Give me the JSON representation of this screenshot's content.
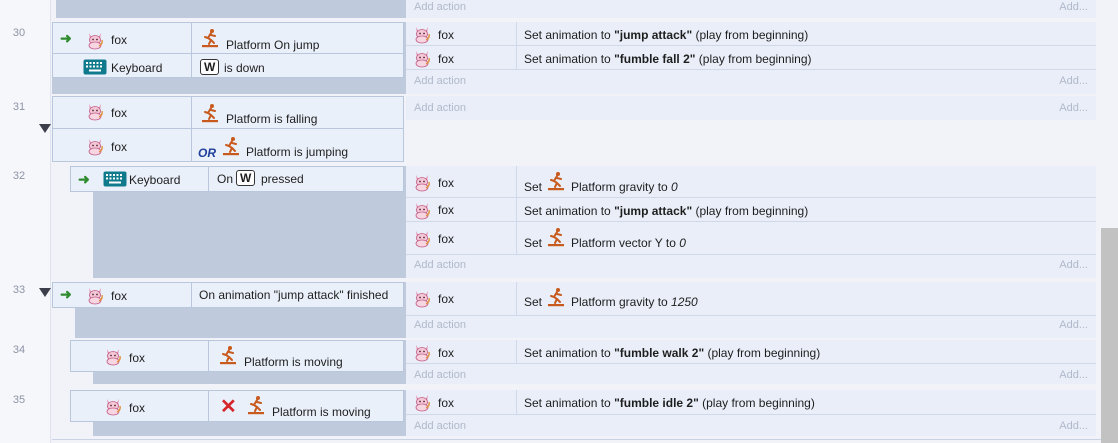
{
  "rows": [
    {
      "num": "30",
      "conditions": [
        {
          "object": "fox",
          "icon": "platform-icon",
          "text": "Platform On jump"
        },
        {
          "object": "Keyboard",
          "key": "W",
          "text": "is down"
        }
      ],
      "actions": [
        {
          "object": "fox",
          "prefix": "Set animation to ",
          "bold": "\"jump attack\"",
          "suffix": " (play from beginning)"
        },
        {
          "object": "fox",
          "prefix": "Set animation to ",
          "bold": "\"fumble fall 2\"",
          "suffix": " (play from beginning)"
        }
      ]
    },
    {
      "num": "31",
      "conditions": [
        {
          "object": "fox",
          "text": "Platform is falling"
        },
        {
          "object": "fox",
          "or": "OR",
          "text": "Platform is jumping"
        }
      ],
      "actions": []
    },
    {
      "num": "32",
      "conditions": [
        {
          "object": "Keyboard",
          "prefix": "On",
          "key": "W",
          "text": "pressed"
        }
      ],
      "actions": [
        {
          "object": "fox",
          "prefix": "Set ",
          "text": "Platform gravity to ",
          "italic": "0"
        },
        {
          "object": "fox",
          "prefix": "Set animation to ",
          "bold": "\"jump attack\"",
          "suffix": " (play from beginning)"
        },
        {
          "object": "fox",
          "prefix": "Set ",
          "text": "Platform vector Y to ",
          "italic": "0"
        }
      ]
    },
    {
      "num": "33",
      "conditions": [
        {
          "object": "fox",
          "text": "On animation \"jump attack\" finished"
        }
      ],
      "actions": [
        {
          "object": "fox",
          "prefix": "Set ",
          "text": "Platform gravity to ",
          "italic": "1250"
        }
      ]
    },
    {
      "num": "34",
      "conditions": [
        {
          "object": "fox",
          "text": "Platform is moving"
        }
      ],
      "actions": [
        {
          "object": "fox",
          "prefix": "Set animation to ",
          "bold": "\"fumble walk 2\"",
          "suffix": " (play from beginning)"
        }
      ]
    },
    {
      "num": "35",
      "conditions": [
        {
          "object": "fox",
          "negated": true,
          "text": "Platform is moving"
        }
      ],
      "actions": [
        {
          "object": "fox",
          "prefix": "Set animation to ",
          "bold": "\"fumble idle 2\"",
          "suffix": " (play from beginning)"
        }
      ]
    }
  ],
  "add_action_label": "Add action",
  "add_right_label": "Add...",
  "colors": {
    "accent_orange": "#c85a1e",
    "arrow_green": "#2e8b2e",
    "or_blue": "#1f3f9a",
    "negate_red": "#d6262b"
  }
}
